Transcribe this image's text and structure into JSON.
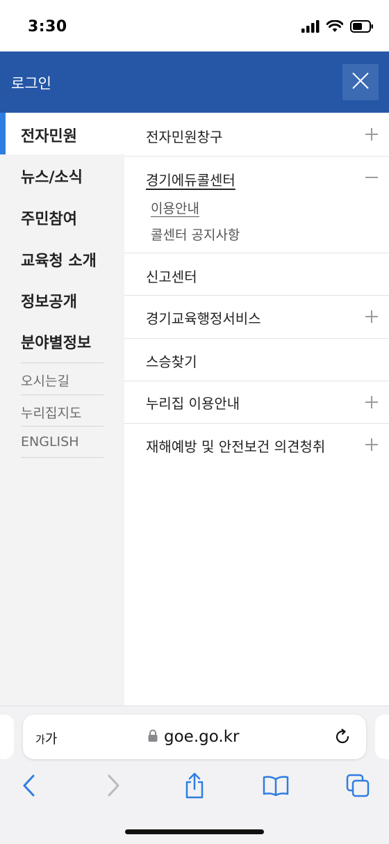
{
  "status_bar": {
    "time": "3:30"
  },
  "header": {
    "login_label": "로그인"
  },
  "left_nav": {
    "items": [
      {
        "label": "전자민원",
        "active": true
      },
      {
        "label": "뉴스/소식"
      },
      {
        "label": "주민참여"
      },
      {
        "label": "교육청 소개"
      },
      {
        "label": "정보공개"
      },
      {
        "label": "분야별정보"
      }
    ],
    "sub_links": [
      {
        "label": "오시는길"
      },
      {
        "label": "누리집지도"
      },
      {
        "label": "ENGLISH"
      }
    ]
  },
  "right_menu": {
    "items": [
      {
        "label": "전자민원창구",
        "toggle": "plus"
      },
      {
        "label": "경기에듀콜센터",
        "toggle": "minus",
        "expanded": true,
        "children": [
          {
            "label": "이용안내",
            "current": true
          },
          {
            "label": "콜센터 공지사항"
          }
        ]
      },
      {
        "label": "신고센터",
        "toggle": "none"
      },
      {
        "label": "경기교육행정서비스",
        "toggle": "plus"
      },
      {
        "label": "스승찾기",
        "toggle": "none"
      },
      {
        "label": "누리집 이용안내",
        "toggle": "plus"
      },
      {
        "label": "재해예방 및 안전보건 의견청취",
        "toggle": "plus"
      }
    ]
  },
  "browser": {
    "text_size_label_small": "가",
    "text_size_label_large": "가",
    "url": "goe.go.kr"
  },
  "colors": {
    "header_bg": "#2557a6",
    "active_indicator": "#2f7de1",
    "safari_blue": "#2f7de1"
  }
}
